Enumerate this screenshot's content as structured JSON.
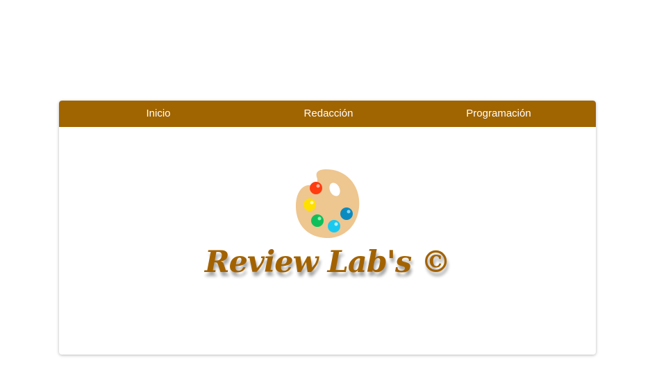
{
  "nav": {
    "items": [
      {
        "label": "Inicio"
      },
      {
        "label": "Redacción"
      },
      {
        "label": "Programación"
      }
    ]
  },
  "logo": {
    "text": "Review Lab's ©",
    "icon": "palette-icon"
  },
  "colors": {
    "navbar": "#a06400",
    "logo_text": "#a36200",
    "palette_body": "#eec690",
    "paint_red": "#ff3d10",
    "paint_yellow": "#ffe000",
    "paint_green": "#0fc05a",
    "paint_cyan": "#19c9f0",
    "paint_blue": "#0a8bc0"
  }
}
